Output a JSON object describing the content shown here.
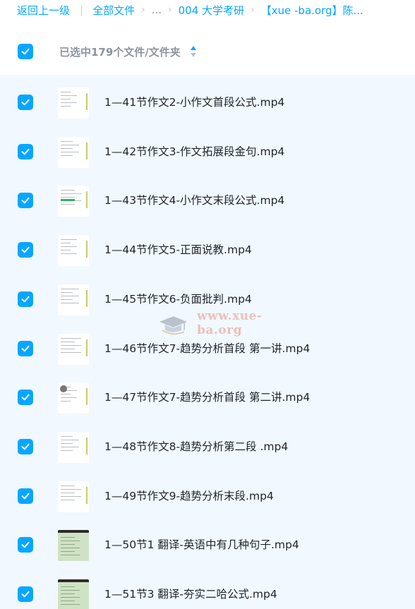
{
  "breadcrumb": {
    "back": "返回上一级",
    "all_files": "全部文件",
    "ellipsis": "...",
    "folder": "004 大学考研",
    "current": "【xue -ba.org】陈..."
  },
  "selection": {
    "label": "已选中179个文件/文件夹"
  },
  "files": [
    {
      "name": "1—41节作文2-小作文首段公式.mp4"
    },
    {
      "name": "1—42节作文3-作文拓展段金句.mp4"
    },
    {
      "name": "1—43节作文4-小作文末段公式.mp4"
    },
    {
      "name": "1—44节作文5-正面说教.mp4"
    },
    {
      "name": "1—45节作文6-负面批判.mp4"
    },
    {
      "name": "1—46节作文7-趋势分析首段 第一讲.mp4"
    },
    {
      "name": "1—47节作文7-趋势分析首段 第二讲.mp4"
    },
    {
      "name": "1—48节作文8-趋势分析第二段 .mp4"
    },
    {
      "name": "1—49节作文9-趋势分析末段.mp4"
    },
    {
      "name": "1—50节1 翻译-英语中有几种句子.mp4"
    },
    {
      "name": "1—51节3 翻译-夯实二哈公式.mp4"
    }
  ],
  "watermark": {
    "text": "www.xue-ba.org"
  },
  "colors": {
    "accent": "#06a7ff",
    "list_bg": "#f1f8ff"
  }
}
